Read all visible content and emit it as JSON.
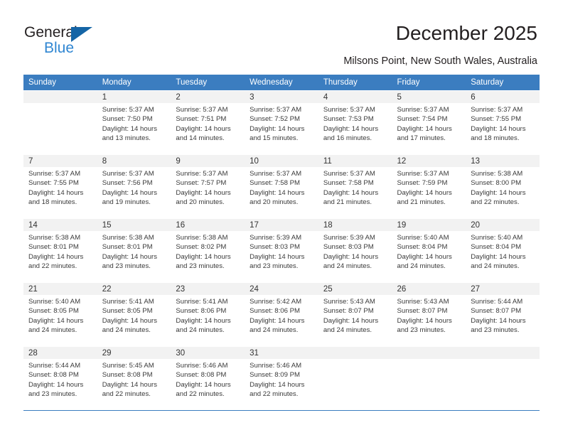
{
  "brand": {
    "name_top": "General",
    "name_bottom": "Blue",
    "accent_blue": "#2f86d2",
    "triangle_blue": "#1565a6"
  },
  "header": {
    "title": "December 2025",
    "subtitle": "Milsons Point, New South Wales, Australia",
    "header_bg": "#3b7dc0",
    "row_divider": "#3b7dc0",
    "daynum_band_bg": "#f2f2f2"
  },
  "weekday_headers": [
    "Sunday",
    "Monday",
    "Tuesday",
    "Wednesday",
    "Thursday",
    "Friday",
    "Saturday"
  ],
  "labels": {
    "sunrise_prefix": "Sunrise: ",
    "sunset_prefix": "Sunset: ",
    "daylight_prefix": "Daylight: "
  },
  "weeks": [
    [
      {
        "day": "",
        "sunrise": "",
        "sunset": "",
        "daylight_line1": "",
        "daylight_line2": ""
      },
      {
        "day": "1",
        "sunrise": "Sunrise: 5:37 AM",
        "sunset": "Sunset: 7:50 PM",
        "daylight_line1": "Daylight: 14 hours",
        "daylight_line2": "and 13 minutes."
      },
      {
        "day": "2",
        "sunrise": "Sunrise: 5:37 AM",
        "sunset": "Sunset: 7:51 PM",
        "daylight_line1": "Daylight: 14 hours",
        "daylight_line2": "and 14 minutes."
      },
      {
        "day": "3",
        "sunrise": "Sunrise: 5:37 AM",
        "sunset": "Sunset: 7:52 PM",
        "daylight_line1": "Daylight: 14 hours",
        "daylight_line2": "and 15 minutes."
      },
      {
        "day": "4",
        "sunrise": "Sunrise: 5:37 AM",
        "sunset": "Sunset: 7:53 PM",
        "daylight_line1": "Daylight: 14 hours",
        "daylight_line2": "and 16 minutes."
      },
      {
        "day": "5",
        "sunrise": "Sunrise: 5:37 AM",
        "sunset": "Sunset: 7:54 PM",
        "daylight_line1": "Daylight: 14 hours",
        "daylight_line2": "and 17 minutes."
      },
      {
        "day": "6",
        "sunrise": "Sunrise: 5:37 AM",
        "sunset": "Sunset: 7:55 PM",
        "daylight_line1": "Daylight: 14 hours",
        "daylight_line2": "and 18 minutes."
      }
    ],
    [
      {
        "day": "7",
        "sunrise": "Sunrise: 5:37 AM",
        "sunset": "Sunset: 7:55 PM",
        "daylight_line1": "Daylight: 14 hours",
        "daylight_line2": "and 18 minutes."
      },
      {
        "day": "8",
        "sunrise": "Sunrise: 5:37 AM",
        "sunset": "Sunset: 7:56 PM",
        "daylight_line1": "Daylight: 14 hours",
        "daylight_line2": "and 19 minutes."
      },
      {
        "day": "9",
        "sunrise": "Sunrise: 5:37 AM",
        "sunset": "Sunset: 7:57 PM",
        "daylight_line1": "Daylight: 14 hours",
        "daylight_line2": "and 20 minutes."
      },
      {
        "day": "10",
        "sunrise": "Sunrise: 5:37 AM",
        "sunset": "Sunset: 7:58 PM",
        "daylight_line1": "Daylight: 14 hours",
        "daylight_line2": "and 20 minutes."
      },
      {
        "day": "11",
        "sunrise": "Sunrise: 5:37 AM",
        "sunset": "Sunset: 7:58 PM",
        "daylight_line1": "Daylight: 14 hours",
        "daylight_line2": "and 21 minutes."
      },
      {
        "day": "12",
        "sunrise": "Sunrise: 5:37 AM",
        "sunset": "Sunset: 7:59 PM",
        "daylight_line1": "Daylight: 14 hours",
        "daylight_line2": "and 21 minutes."
      },
      {
        "day": "13",
        "sunrise": "Sunrise: 5:38 AM",
        "sunset": "Sunset: 8:00 PM",
        "daylight_line1": "Daylight: 14 hours",
        "daylight_line2": "and 22 minutes."
      }
    ],
    [
      {
        "day": "14",
        "sunrise": "Sunrise: 5:38 AM",
        "sunset": "Sunset: 8:01 PM",
        "daylight_line1": "Daylight: 14 hours",
        "daylight_line2": "and 22 minutes."
      },
      {
        "day": "15",
        "sunrise": "Sunrise: 5:38 AM",
        "sunset": "Sunset: 8:01 PM",
        "daylight_line1": "Daylight: 14 hours",
        "daylight_line2": "and 23 minutes."
      },
      {
        "day": "16",
        "sunrise": "Sunrise: 5:38 AM",
        "sunset": "Sunset: 8:02 PM",
        "daylight_line1": "Daylight: 14 hours",
        "daylight_line2": "and 23 minutes."
      },
      {
        "day": "17",
        "sunrise": "Sunrise: 5:39 AM",
        "sunset": "Sunset: 8:03 PM",
        "daylight_line1": "Daylight: 14 hours",
        "daylight_line2": "and 23 minutes."
      },
      {
        "day": "18",
        "sunrise": "Sunrise: 5:39 AM",
        "sunset": "Sunset: 8:03 PM",
        "daylight_line1": "Daylight: 14 hours",
        "daylight_line2": "and 24 minutes."
      },
      {
        "day": "19",
        "sunrise": "Sunrise: 5:40 AM",
        "sunset": "Sunset: 8:04 PM",
        "daylight_line1": "Daylight: 14 hours",
        "daylight_line2": "and 24 minutes."
      },
      {
        "day": "20",
        "sunrise": "Sunrise: 5:40 AM",
        "sunset": "Sunset: 8:04 PM",
        "daylight_line1": "Daylight: 14 hours",
        "daylight_line2": "and 24 minutes."
      }
    ],
    [
      {
        "day": "21",
        "sunrise": "Sunrise: 5:40 AM",
        "sunset": "Sunset: 8:05 PM",
        "daylight_line1": "Daylight: 14 hours",
        "daylight_line2": "and 24 minutes."
      },
      {
        "day": "22",
        "sunrise": "Sunrise: 5:41 AM",
        "sunset": "Sunset: 8:05 PM",
        "daylight_line1": "Daylight: 14 hours",
        "daylight_line2": "and 24 minutes."
      },
      {
        "day": "23",
        "sunrise": "Sunrise: 5:41 AM",
        "sunset": "Sunset: 8:06 PM",
        "daylight_line1": "Daylight: 14 hours",
        "daylight_line2": "and 24 minutes."
      },
      {
        "day": "24",
        "sunrise": "Sunrise: 5:42 AM",
        "sunset": "Sunset: 8:06 PM",
        "daylight_line1": "Daylight: 14 hours",
        "daylight_line2": "and 24 minutes."
      },
      {
        "day": "25",
        "sunrise": "Sunrise: 5:43 AM",
        "sunset": "Sunset: 8:07 PM",
        "daylight_line1": "Daylight: 14 hours",
        "daylight_line2": "and 24 minutes."
      },
      {
        "day": "26",
        "sunrise": "Sunrise: 5:43 AM",
        "sunset": "Sunset: 8:07 PM",
        "daylight_line1": "Daylight: 14 hours",
        "daylight_line2": "and 23 minutes."
      },
      {
        "day": "27",
        "sunrise": "Sunrise: 5:44 AM",
        "sunset": "Sunset: 8:07 PM",
        "daylight_line1": "Daylight: 14 hours",
        "daylight_line2": "and 23 minutes."
      }
    ],
    [
      {
        "day": "28",
        "sunrise": "Sunrise: 5:44 AM",
        "sunset": "Sunset: 8:08 PM",
        "daylight_line1": "Daylight: 14 hours",
        "daylight_line2": "and 23 minutes."
      },
      {
        "day": "29",
        "sunrise": "Sunrise: 5:45 AM",
        "sunset": "Sunset: 8:08 PM",
        "daylight_line1": "Daylight: 14 hours",
        "daylight_line2": "and 22 minutes."
      },
      {
        "day": "30",
        "sunrise": "Sunrise: 5:46 AM",
        "sunset": "Sunset: 8:08 PM",
        "daylight_line1": "Daylight: 14 hours",
        "daylight_line2": "and 22 minutes."
      },
      {
        "day": "31",
        "sunrise": "Sunrise: 5:46 AM",
        "sunset": "Sunset: 8:09 PM",
        "daylight_line1": "Daylight: 14 hours",
        "daylight_line2": "and 22 minutes."
      },
      {
        "day": "",
        "sunrise": "",
        "sunset": "",
        "daylight_line1": "",
        "daylight_line2": ""
      },
      {
        "day": "",
        "sunrise": "",
        "sunset": "",
        "daylight_line1": "",
        "daylight_line2": ""
      },
      {
        "day": "",
        "sunrise": "",
        "sunset": "",
        "daylight_line1": "",
        "daylight_line2": ""
      }
    ]
  ]
}
